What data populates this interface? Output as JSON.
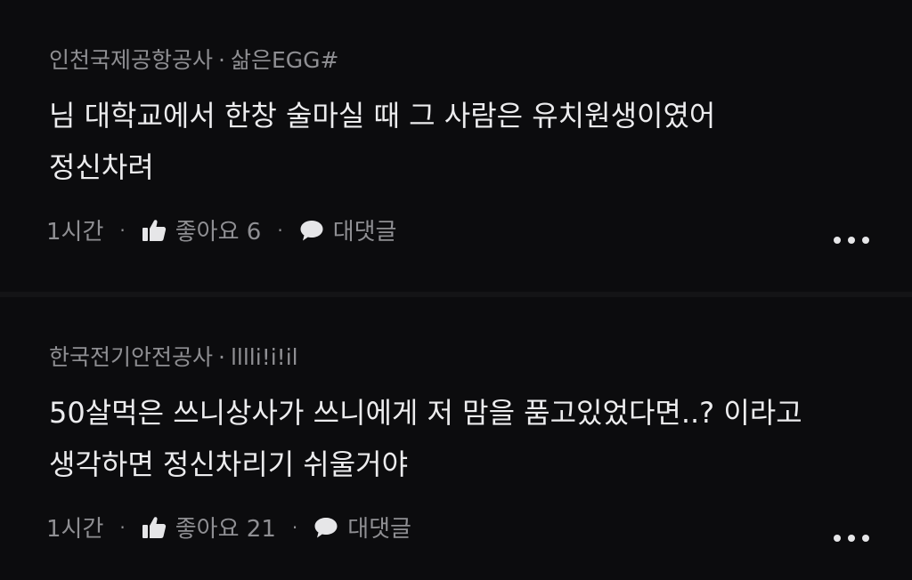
{
  "comments": [
    {
      "company": "인천국제공항공사",
      "separator": "·",
      "nickname": "삶은EGG#",
      "lines": [
        "님 대학교에서 한창 술마실 때 그 사람은 유치원생이였어",
        "정신차려"
      ],
      "time": "1시간",
      "like_label": "좋아요 6",
      "reply_label": "대댓글",
      "dot": "·"
    },
    {
      "company": "한국전기안전공사",
      "separator": "·",
      "nickname": "lllli!i!il",
      "lines": [
        "50살먹은 쓰니상사가 쓰니에게 저 맘을 품고있었다면..? 이라고",
        "생각하면 정신차리기 쉬울거야"
      ],
      "time": "1시간",
      "like_label": "좋아요 21",
      "reply_label": "대댓글",
      "dot": "·"
    }
  ],
  "icons": {
    "like": "thumbs-up-icon",
    "reply": "speech-bubble-icon",
    "more": "more-horizontal-icon"
  },
  "colors": {
    "background": "#0c0c0e",
    "meta_text": "#8f8f93",
    "body_text": "#ececee"
  }
}
